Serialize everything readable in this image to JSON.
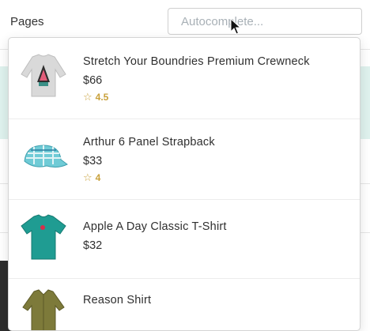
{
  "header": {
    "nav_label": "Pages",
    "search": {
      "placeholder": "Autocomplete...",
      "value": ""
    }
  },
  "dropdown": {
    "items": [
      {
        "name": "Stretch Your Boundries Premium Crewneck",
        "price": "$66",
        "rating": "4.5",
        "image_icon": "sweater-icon"
      },
      {
        "name": "Arthur 6 Panel Strapback",
        "price": "$33",
        "rating": "4",
        "image_icon": "cap-icon"
      },
      {
        "name": "Apple A Day Classic T-Shirt",
        "price": "$32",
        "rating": "",
        "image_icon": "tshirt-icon"
      },
      {
        "name": "Reason Shirt",
        "price": "",
        "rating": "",
        "image_icon": "shirt-icon"
      }
    ]
  },
  "colors": {
    "accent_teal": "#dff2ee",
    "star": "#c9a13b",
    "lime": "#c8e61c"
  }
}
